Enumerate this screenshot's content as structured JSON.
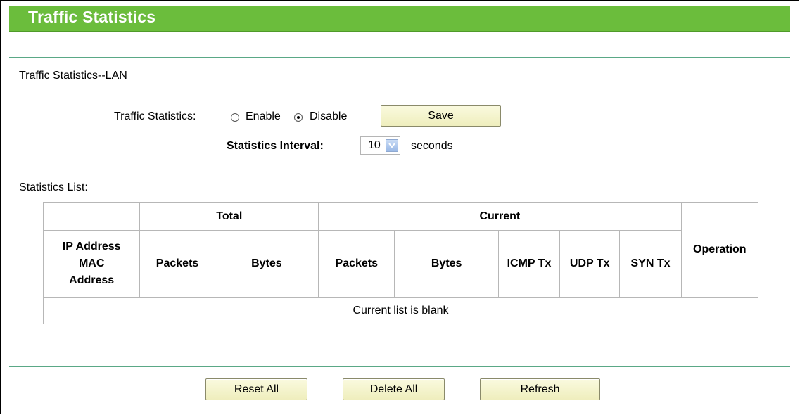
{
  "header": {
    "title": "Traffic Statistics"
  },
  "section": {
    "title": "Traffic Statistics--LAN"
  },
  "settings": {
    "traffic_label": "Traffic Statistics:",
    "enable_label": "Enable",
    "disable_label": "Disable",
    "selected": "Disable",
    "save_label": "Save",
    "interval_label": "Statistics Interval:",
    "interval_value": "10",
    "interval_unit": "seconds"
  },
  "list": {
    "title": "Statistics List:",
    "headers": {
      "total": "Total",
      "current": "Current",
      "ip_line1": "IP Address",
      "ip_line2": "MAC",
      "ip_line3": "Address",
      "total_packets": "Packets",
      "total_bytes": "Bytes",
      "current_packets": "Packets",
      "current_bytes": "Bytes",
      "icmp_tx": "ICMP Tx",
      "udp_tx": "UDP Tx",
      "syn_tx": "SYN Tx",
      "operation": "Operation"
    },
    "empty_message": "Current list is blank"
  },
  "footer": {
    "reset_all_label": "Reset All",
    "delete_all_label": "Delete All",
    "refresh_label": "Refresh"
  },
  "colors": {
    "title_bar": "#6bbd3c",
    "divider": "#5aa886",
    "button_bg": "#efeebd"
  }
}
